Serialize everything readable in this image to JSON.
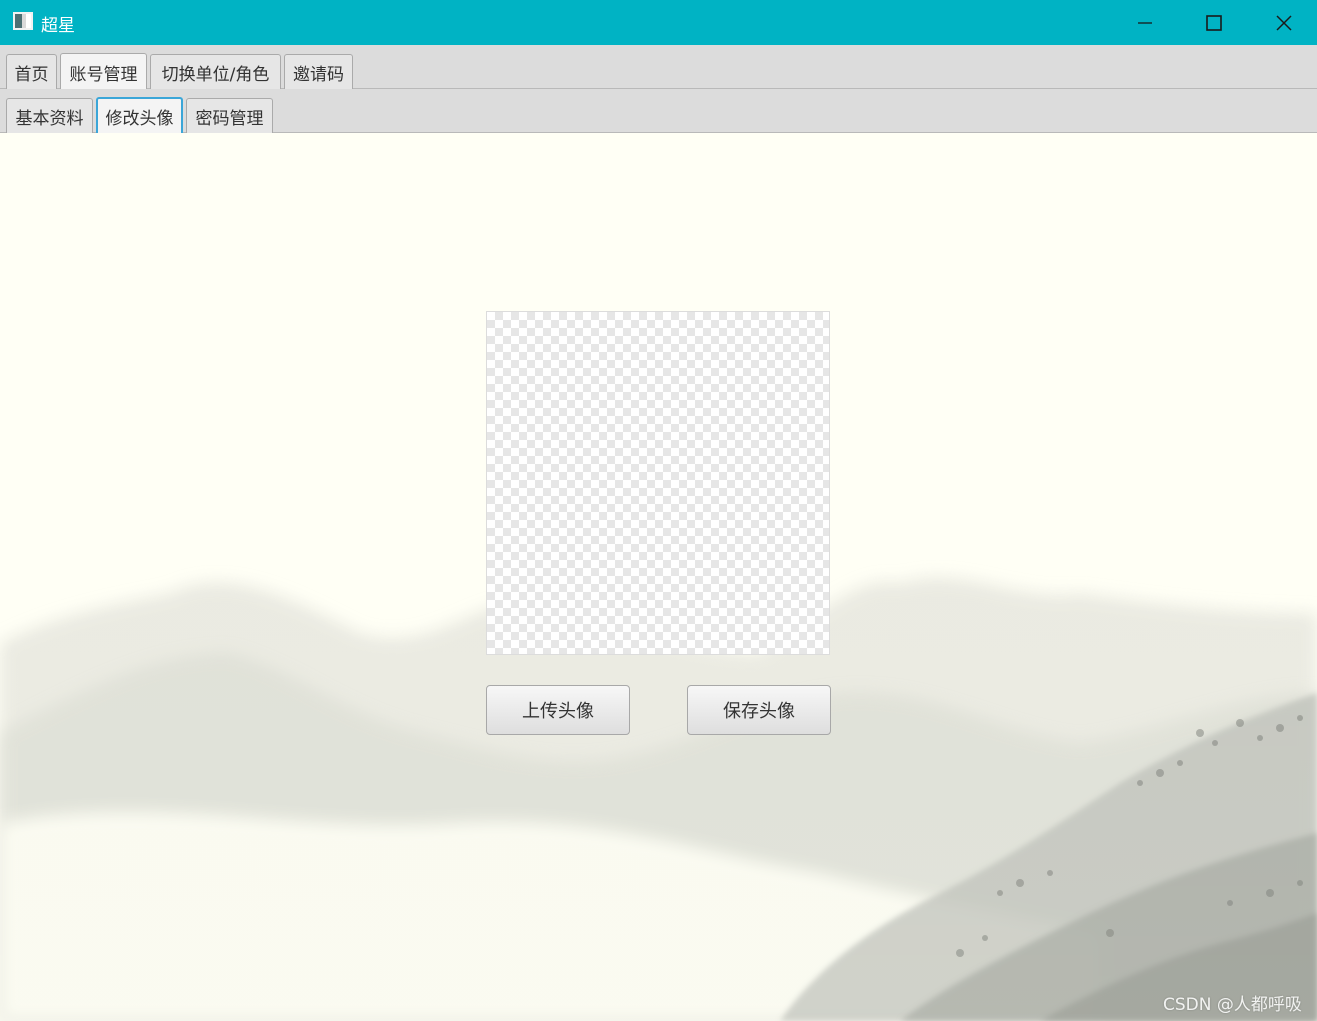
{
  "window": {
    "title": "超星",
    "accent_color": "#00b3c4",
    "controls": [
      "minimize-icon",
      "maximize-icon",
      "close-icon"
    ]
  },
  "main_tabs": [
    {
      "label": "首页",
      "selected": false
    },
    {
      "label": "账号管理",
      "selected": true
    },
    {
      "label": "切换单位/角色",
      "selected": false
    },
    {
      "label": "邀请码",
      "selected": false
    }
  ],
  "sub_tabs": [
    {
      "label": "基本资料",
      "selected": false
    },
    {
      "label": "修改头像",
      "selected": true
    },
    {
      "label": "密码管理",
      "selected": false
    }
  ],
  "avatar": {
    "upload_label": "上传头像",
    "save_label": "保存头像"
  },
  "watermark": "CSDN @人都呼吸"
}
